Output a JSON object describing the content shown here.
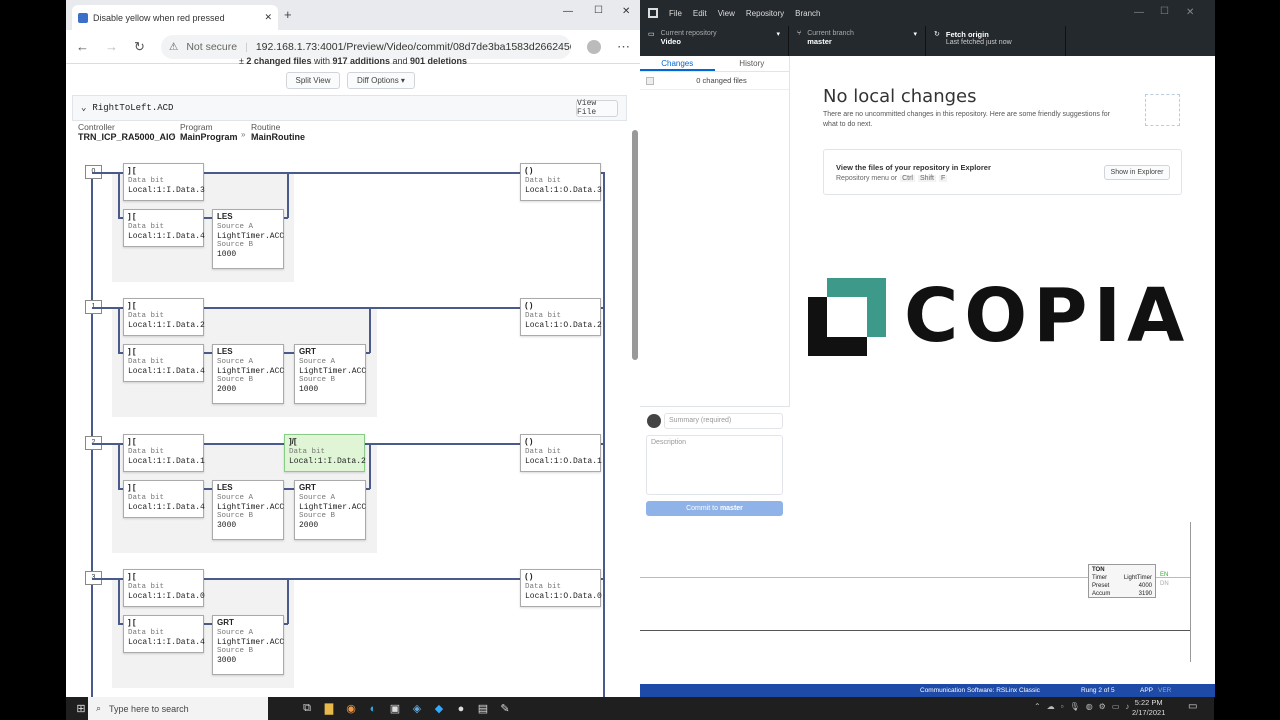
{
  "browser": {
    "tab_title": "Disable yellow when red pressed",
    "window_controls": [
      "—",
      "☐",
      "✕"
    ],
    "address_security": "Not secure",
    "address_url": "192.168.1.73:4001/Preview/Video/commit/08d7de3ba1583d2662450f6a5..."
  },
  "diff": {
    "summary_pre": "±",
    "summary_files": "2 changed files",
    "summary_mid": " with ",
    "summary_additions": "917 additions",
    "summary_and": " and ",
    "summary_deletions": "901 deletions",
    "split_view": "Split View",
    "diff_options": "Diff Options",
    "file_name": "RightToLeft.ACD",
    "view_file": "View File",
    "crumbs": [
      {
        "label": "Controller",
        "value": "TRN_ICP_RA5000_AIO"
      },
      {
        "label": "Program",
        "value": "MainProgram"
      },
      {
        "label": "Routine",
        "value": "MainRoutine"
      }
    ]
  },
  "ladder": {
    "rungs": [
      {
        "num": "0",
        "a": {
          "sym": "] [",
          "l": "Data bit",
          "v": "Local:1:I.Data.3"
        },
        "b": {
          "sym": "] [",
          "l": "Data bit",
          "v": "Local:1:I.Data.4"
        },
        "c": {
          "h": "LES",
          "l1": "Source A",
          "v1": "LightTimer.ACC",
          "l2": "Source B",
          "v2": "1000"
        },
        "out": {
          "sym": "( )",
          "l": "Data bit",
          "v": "Local:1:O.Data.3"
        }
      },
      {
        "num": "1",
        "a": {
          "sym": "] [",
          "l": "Data bit",
          "v": "Local:1:I.Data.2"
        },
        "b": {
          "sym": "] [",
          "l": "Data bit",
          "v": "Local:1:I.Data.4"
        },
        "c": {
          "h": "LES",
          "l1": "Source A",
          "v1": "LightTimer.ACC",
          "l2": "Source B",
          "v2": "2000"
        },
        "d": {
          "h": "GRT",
          "l1": "Source A",
          "v1": "LightTimer.ACC",
          "l2": "Source B",
          "v2": "1000"
        },
        "out": {
          "sym": "( )",
          "l": "Data bit",
          "v": "Local:1:O.Data.2"
        }
      },
      {
        "num": "2",
        "a": {
          "sym": "] [",
          "l": "Data bit",
          "v": "Local:1:I.Data.1"
        },
        "x": {
          "sym": "]/[",
          "l": "Data bit",
          "v": "Local:1:I.Data.2"
        },
        "b": {
          "sym": "] [",
          "l": "Data bit",
          "v": "Local:1:I.Data.4"
        },
        "c": {
          "h": "LES",
          "l1": "Source A",
          "v1": "LightTimer.ACC",
          "l2": "Source B",
          "v2": "3000"
        },
        "d": {
          "h": "GRT",
          "l1": "Source A",
          "v1": "LightTimer.ACC",
          "l2": "Source B",
          "v2": "2000"
        },
        "out": {
          "sym": "( )",
          "l": "Data bit",
          "v": "Local:1:O.Data.1"
        }
      },
      {
        "num": "3",
        "a": {
          "sym": "] [",
          "l": "Data bit",
          "v": "Local:1:I.Data.0"
        },
        "b": {
          "sym": "] [",
          "l": "Data bit",
          "v": "Local:1:I.Data.4"
        },
        "c": {
          "h": "GRT",
          "l1": "Source A",
          "v1": "LightTimer.ACC",
          "l2": "Source B",
          "v2": "3000"
        },
        "out": {
          "sym": "( )",
          "l": "Data bit",
          "v": "Local:1:O.Data.0"
        }
      }
    ]
  },
  "desktop": {
    "menu": [
      "File",
      "Edit",
      "View",
      "Repository",
      "Branch"
    ],
    "window_controls": [
      "—",
      "☐",
      "✕"
    ],
    "repo_label": "Current repository",
    "repo_value": "Video",
    "branch_label": "Current branch",
    "branch_value": "master",
    "fetch_label": "Fetch origin",
    "fetch_sub": "Last fetched just now",
    "tab_changes": "Changes",
    "tab_history": "History",
    "changed_files": "0 changed files",
    "summary_placeholder": "Summary (required)",
    "description_placeholder": "Description",
    "commit_prefix": "Commit to ",
    "commit_branch": "master",
    "no_changes_title": "No local changes",
    "no_changes_text": "There are no uncommitted changes in this repository. Here are some friendly suggestions for what to do next.",
    "explorer_title": "View the files of your repository in Explorer",
    "explorer_sub": "Repository menu or",
    "keys": [
      "Ctrl",
      "Shift",
      "F"
    ],
    "show_explorer": "Show in Explorer",
    "logo_text": "COPIA",
    "logo_color": "#3d9a8b"
  },
  "rslinx": {
    "ton": "TON",
    "timer_label": "Timer",
    "timer_value": "LightTimer",
    "preset_label": "Preset",
    "preset_value": "4000",
    "accum_label": "Accum",
    "accum_value": "3190",
    "en": "EN",
    "dn": "DN",
    "status_comm": "Communication Software: RSLinx Classic",
    "status_rung": "Rung 2 of 5",
    "status_app": "APP",
    "status_ver": "VER"
  },
  "taskbar": {
    "search_placeholder": "Type here to search",
    "time": "5:22 PM",
    "date": "2/17/2021"
  }
}
